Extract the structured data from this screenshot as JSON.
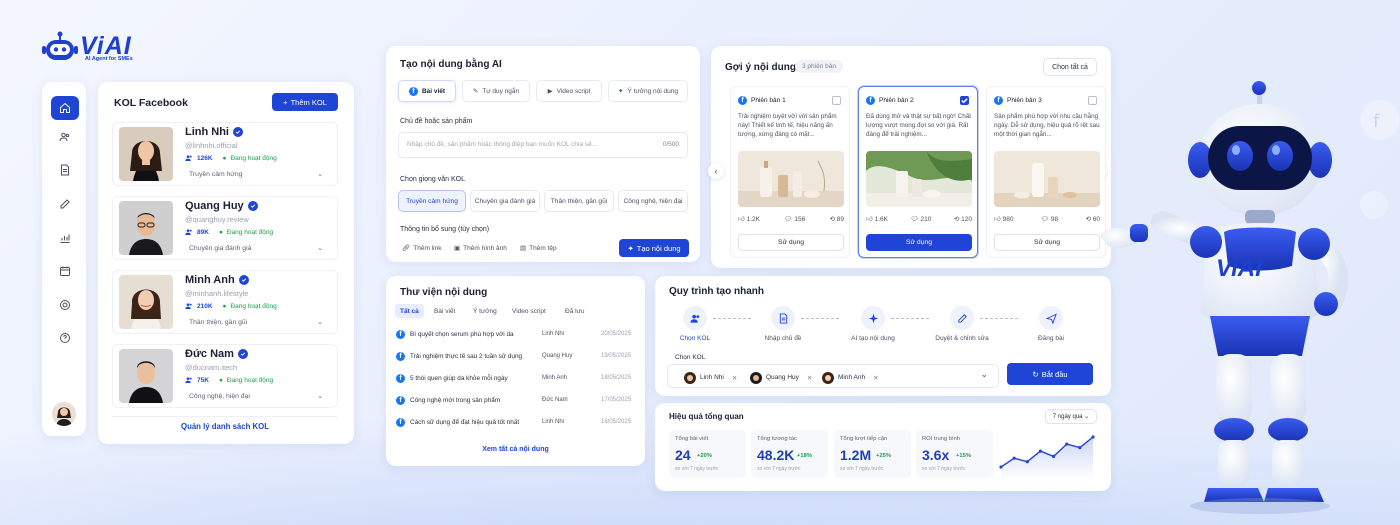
{
  "brand": {
    "logo": "ViAI",
    "tagline": "AI Agent for SMEs",
    "mascot_chest": "ViAI",
    "accent": "#1f45d6"
  },
  "sidebar": {
    "items": [
      "home-icon",
      "users-icon",
      "document-icon",
      "edit-icon",
      "chart-icon",
      "calendar-icon",
      "target-icon",
      "help-icon"
    ]
  },
  "kol": {
    "title": "KOL Facebook",
    "add_label": "Thêm KOL",
    "items": [
      {
        "name": "Linh Nhi",
        "handle": "@linhnhi.official",
        "followers": "126K",
        "status": "Đang hoạt động",
        "style": "Truyền cảm hứng"
      },
      {
        "name": "Quang Huy",
        "handle": "@quanghuy.review",
        "followers": "89K",
        "status": "Đang hoạt động",
        "style": "Chuyên gia đánh giá"
      },
      {
        "name": "Minh Anh",
        "handle": "@minhanh.lifestyle",
        "followers": "210K",
        "status": "Đang hoạt động",
        "style": "Thân thiện, gần gũi"
      },
      {
        "name": "Đức Nam",
        "handle": "@ducnam.itech",
        "followers": "75K",
        "status": "Đang hoạt động",
        "style": "Công nghệ, hiện đại"
      }
    ],
    "manage_label": "Quản lý danh sách KOL"
  },
  "create": {
    "title": "Tạo nội dung bằng AI",
    "tabs": [
      "Bài viết",
      "Tư duy ngắn",
      "Video script",
      "Ý tưởng nội dung"
    ],
    "topic_label": "Chủ đề hoặc sản phẩm",
    "topic_placeholder": "Nhập chủ đề, sản phẩm hoặc thông điệp bạn muốn KOL chia sẻ...",
    "counter": "0/500",
    "voice_label": "Chọn giọng văn KOL",
    "voices": [
      "Truyền cảm hứng",
      "Chuyên gia đánh giá",
      "Thân thiện, gần gũi",
      "Công nghệ, hiện đại"
    ],
    "extra_label": "Thông tin bổ sung (tùy chọn)",
    "extras": [
      "Thêm link",
      "Thêm hình ảnh",
      "Thêm tệp"
    ],
    "generate_label": "Tạo nội dung"
  },
  "suggest": {
    "title": "Gợi ý nội dung",
    "badge": "3 phiên bản",
    "select_all": "Chọn tất cả",
    "versions": [
      {
        "label": "Phiên bản 1",
        "text": "Trải nghiệm tuyệt vời với sản phẩm này! Thiết kế tinh tế, hiệu năng ấn tượng, xứng đáng có mặt...",
        "likes": "1.2K",
        "comments": "156",
        "shares": "89",
        "use": "Sử dụng",
        "checked": false
      },
      {
        "label": "Phiên bản 2",
        "text": "Đã dùng thử và thật sự bất ngờ! Chất lượng vượt mong đợi so với giá. Rất đáng để trải nghiệm...",
        "likes": "1.6K",
        "comments": "210",
        "shares": "120",
        "use": "Sử dụng",
        "checked": true
      },
      {
        "label": "Phiên bản 3",
        "text": "Sản phẩm phù hợp với nhu cầu hằng ngày. Dễ sử dụng, hiệu quả rõ rệt sau một thời gian ngắn...",
        "likes": "980",
        "comments": "98",
        "shares": "60",
        "use": "Sử dụng",
        "checked": false
      }
    ]
  },
  "library": {
    "title": "Thư viện nội dung",
    "tabs": [
      "Tất cả",
      "Bài viết",
      "Ý tưởng",
      "Video script",
      "Đã lưu"
    ],
    "rows": [
      {
        "title": "Bí quyết chọn serum phù hợp với da",
        "author": "Linh Nhi",
        "date": "20/05/2025"
      },
      {
        "title": "Trải nghiệm thực tế sau 2 tuần sử dụng",
        "author": "Quang Huy",
        "date": "19/05/2025"
      },
      {
        "title": "5 thói quen giúp da khỏe mỗi ngày",
        "author": "Minh Anh",
        "date": "18/05/2025"
      },
      {
        "title": "Công nghệ mới trong sản phẩm",
        "author": "Đức Nam",
        "date": "17/05/2025"
      },
      {
        "title": "Cách sử dụng để đạt hiệu quả tốt nhất",
        "author": "Linh Nhi",
        "date": "16/05/2025"
      }
    ],
    "more": "Xem tất cả nội dung"
  },
  "flow": {
    "title": "Quy trình tạo nhanh",
    "steps": [
      "Chọn KOL",
      "Nhập chủ đề",
      "AI tạo nội dung",
      "Duyệt & chỉnh sửa",
      "Đăng bài"
    ],
    "kol_label": "Chọn KOL",
    "selected": [
      "Linh Nhi",
      "Quang Huy",
      "Minh Anh"
    ],
    "start": "Bắt đầu"
  },
  "overview": {
    "title": "Hiệu quả tổng quan",
    "range": "7 ngày qua",
    "stats": [
      {
        "label": "Tổng bài viết",
        "value": "24",
        "change": "+20%",
        "note": "so với 7 ngày trước"
      },
      {
        "label": "Tổng tương tác",
        "value": "48.2K",
        "change": "+18%",
        "note": "so với 7 ngày trước"
      },
      {
        "label": "Tổng lượt tiếp cận",
        "value": "1.2M",
        "change": "+25%",
        "note": "so với 7 ngày trước"
      },
      {
        "label": "ROI trung bình",
        "value": "3.6x",
        "change": "+15%",
        "note": "so với 7 ngày trước"
      }
    ],
    "sparkline": [
      2,
      3,
      2.6,
      3.8,
      3.2,
      4.6,
      4.2,
      5.4
    ]
  }
}
